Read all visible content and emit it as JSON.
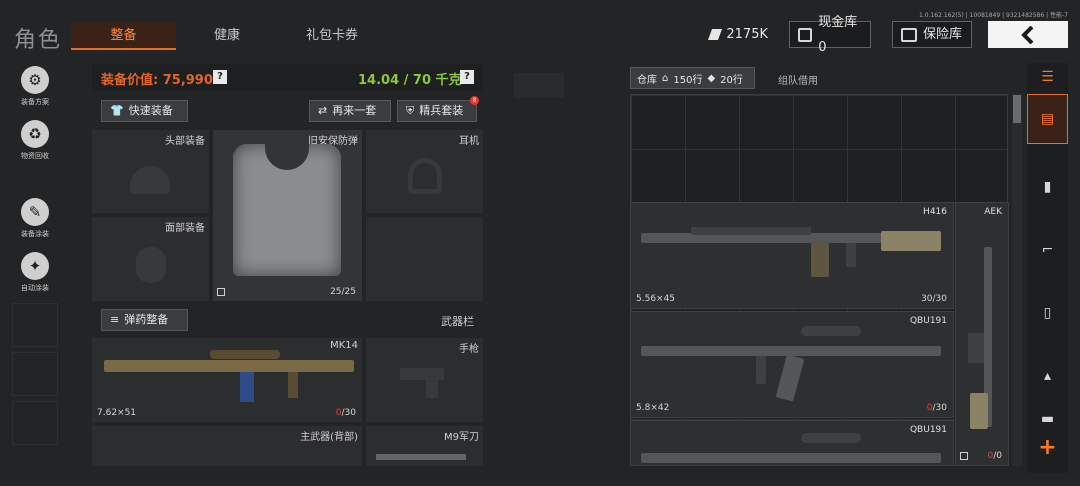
{
  "header": {
    "title": "角色",
    "tabs": [
      {
        "label": "整备",
        "active": true
      },
      {
        "label": "健康",
        "active": false
      },
      {
        "label": "礼包卡券",
        "active": false
      }
    ],
    "version": "1.0.162.162(5) | 10081849 | 9321482586 | 性能-7",
    "cash": "2175K",
    "vault": "现金库 0",
    "insurance": "保险库",
    "back_icon": "chevron-left-icon"
  },
  "sidebar": {
    "items": [
      {
        "label": "装备方案",
        "icon": "loadout-icon"
      },
      {
        "label": "物资回收",
        "icon": "recycle-icon"
      },
      {
        "label": "装备涂装",
        "icon": "paint-icon"
      },
      {
        "label": "自动涂装",
        "icon": "auto-paint-icon"
      }
    ]
  },
  "equipment": {
    "value_label": "装备价值: 75,990",
    "weight": "14.04 / 70 千克",
    "help": "?",
    "quick_equip": "快速装备",
    "again": "再来一套",
    "elite": "精兵套装",
    "elite_badge": "8",
    "slots": {
      "head": "头部装备",
      "armor": "旧安保防弹",
      "armor_durability": "25/25",
      "headset": "耳机",
      "face": "面部装备"
    },
    "ammo_button": "弹药整备",
    "weapon_bar": "武器栏",
    "primary": {
      "name": "MK14",
      "caliber": "7.62×51",
      "ammo_current": "0",
      "ammo_total": "/30"
    },
    "pistol": "手枪",
    "back_weapon": "主武器(背部)",
    "knife": "M9军刀"
  },
  "storage": {
    "tab_label": "仓库",
    "rows": "150行",
    "tag_rows": "20行",
    "team_tab": "组队借用",
    "items": [
      {
        "name": "H416",
        "caliber": "5.56×45",
        "durability": "30/30"
      },
      {
        "name": "QBU191",
        "caliber": "5.8×42",
        "ammo_current": "0",
        "ammo_total": "/30"
      },
      {
        "name": "QBU191"
      },
      {
        "name": "AEK",
        "ammo_current": "0",
        "ammo_total": "/0"
      }
    ]
  },
  "filters": {
    "icons": [
      "storage-icon",
      "bag-icon",
      "vest-icon",
      "rifle-icon",
      "magazine-icon",
      "ammo-icon",
      "more-icon"
    ],
    "add": "+"
  },
  "colors": {
    "accent": "#e86f24",
    "value": "#e2662a",
    "weight": "#8dc63f",
    "danger": "#e0433a"
  }
}
